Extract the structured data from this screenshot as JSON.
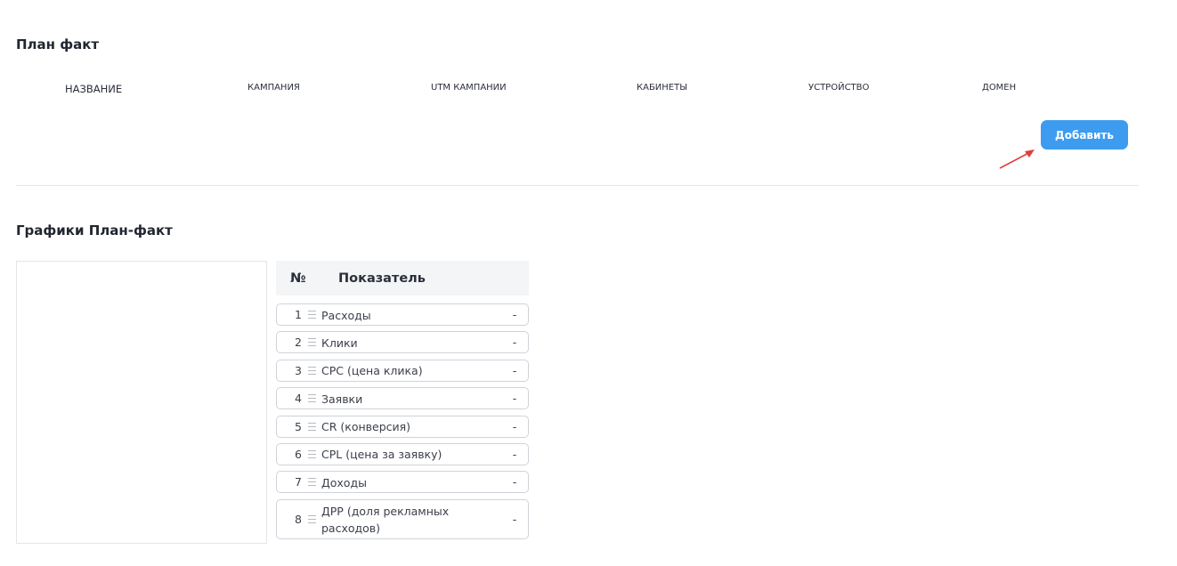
{
  "plan_fact": {
    "title": "План факт",
    "columns": [
      "НАЗВАНИЕ",
      "КАМПАНИЯ",
      "UTM КАМПАНИИ",
      "КАБИНЕТЫ",
      "УСТРОЙСТВО",
      "ДОМЕН"
    ],
    "add_button_label": "Добавить"
  },
  "charts": {
    "title": "Графики План-факт",
    "table": {
      "headers": {
        "num": "№",
        "indicator": "Показатель"
      },
      "rows": [
        {
          "num": "1",
          "label": "Расходы",
          "value": "-"
        },
        {
          "num": "2",
          "label": "Клики",
          "value": "-"
        },
        {
          "num": "3",
          "label": "CPC (цена клика)",
          "value": "-"
        },
        {
          "num": "4",
          "label": "Заявки",
          "value": "-"
        },
        {
          "num": "5",
          "label": "CR (конверсия)",
          "value": "-"
        },
        {
          "num": "6",
          "label": "CPL (цена за заявку)",
          "value": "-"
        },
        {
          "num": "7",
          "label": "Доходы",
          "value": "-"
        },
        {
          "num": "8",
          "label": "ДРР (доля рекламных расходов)",
          "value": "-"
        }
      ]
    }
  },
  "icons": {
    "drag_handle": "drag-handle-icon",
    "annotation_arrow": "arrow-icon"
  },
  "colors": {
    "accent": "#3d9cf0",
    "arrow": "#e0403a"
  }
}
